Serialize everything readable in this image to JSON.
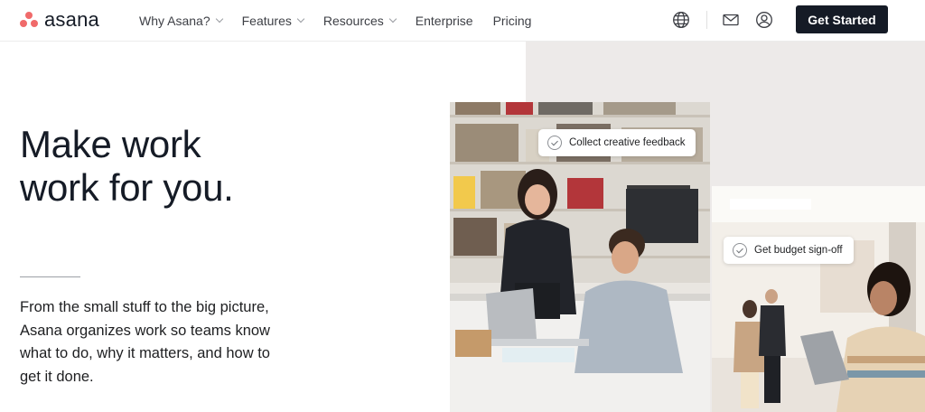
{
  "nav": {
    "logo_text": "asana",
    "links": [
      {
        "label": "Why Asana?",
        "has_dropdown": true
      },
      {
        "label": "Features",
        "has_dropdown": true
      },
      {
        "label": "Resources",
        "has_dropdown": true
      },
      {
        "label": "Enterprise",
        "has_dropdown": false
      },
      {
        "label": "Pricing",
        "has_dropdown": false
      }
    ],
    "icons": [
      "globe-icon",
      "mail-icon",
      "account-icon"
    ],
    "cta_label": "Get Started"
  },
  "hero": {
    "headline_line1": "Make work",
    "headline_line2": "work for you.",
    "description": "From the small stuff to the big picture, Asana organizes work so teams know what to do, why it matters, and how to get it done.",
    "task_chips": [
      {
        "label": "Collect creative feedback"
      },
      {
        "label": "Get budget sign-off"
      }
    ]
  },
  "colors": {
    "brand_coral": "#f06a6a",
    "cta_bg": "#151b26",
    "hero_panel_bg": "#edeae9"
  }
}
